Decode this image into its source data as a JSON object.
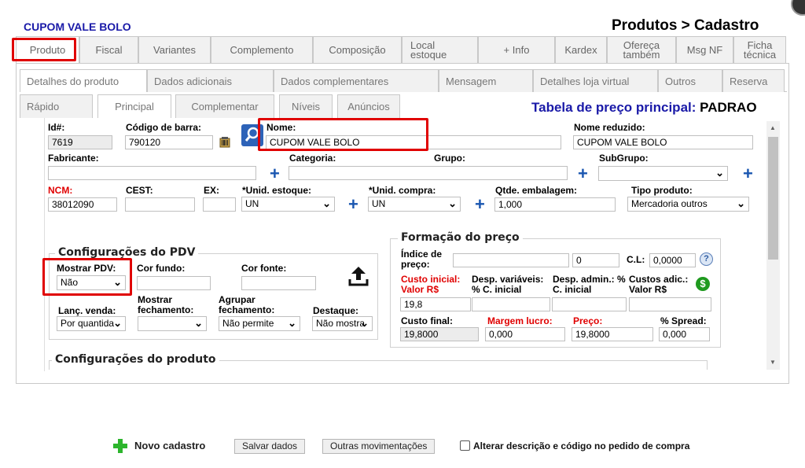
{
  "header": {
    "app_title": "CUPOM VALE BOLO",
    "page_title": "Produtos > Cadastro"
  },
  "tabs_main": [
    {
      "label": "Produto",
      "active": true
    },
    {
      "label": "Fiscal"
    },
    {
      "label": "Variantes"
    },
    {
      "label": "Complemento"
    },
    {
      "label": "Composição"
    },
    {
      "label": "Local estoque"
    },
    {
      "label": "+ Info"
    },
    {
      "label": "Kardex"
    },
    {
      "label": "Ofereça também"
    },
    {
      "label": "Msg NF"
    },
    {
      "label": "Ficha técnica"
    }
  ],
  "tabs_detail": [
    {
      "label": "Detalhes do produto",
      "active": true
    },
    {
      "label": "Dados adicionais"
    },
    {
      "label": "Dados complementares"
    },
    {
      "label": "Mensagem"
    },
    {
      "label": "Detalhes loja virtual"
    },
    {
      "label": "Outros"
    },
    {
      "label": "Reserva"
    }
  ],
  "tabs_sub": [
    {
      "label": "Rápido"
    },
    {
      "label": "Principal",
      "active": true
    },
    {
      "label": "Complementar"
    },
    {
      "label": "Níveis"
    },
    {
      "label": "Anúncios"
    }
  ],
  "price_table": {
    "label": "Tabela de preço principal:",
    "value": "PADRAO"
  },
  "form": {
    "id_label": "Id#:",
    "id_value": "7619",
    "barcode_label": "Código de barra:",
    "barcode_value": "790120",
    "name_label": "Nome:",
    "name_value": "CUPOM VALE BOLO",
    "short_name_label": "Nome reduzido:",
    "short_name_value": "CUPOM VALE BOLO",
    "manufacturer_label": "Fabricante:",
    "manufacturer_value": "",
    "category_label": "Categoria:",
    "category_value": "",
    "group_label": "Grupo:",
    "group_value": "",
    "subgroup_label": "SubGrupo:",
    "subgroup_value": "",
    "ncm_label": "NCM:",
    "ncm_value": "38012090",
    "cest_label": "CEST:",
    "cest_value": "",
    "ex_label": "EX:",
    "ex_value": "",
    "unit_stock_label": "*Unid. estoque:",
    "unit_stock_value": "UN",
    "unit_purchase_label": "*Unid. compra:",
    "unit_purchase_value": "UN",
    "package_qty_label": "Qtde. embalagem:",
    "package_qty_value": "1,000",
    "product_type_label": "Tipo produto:",
    "product_type_value": "Mercadoria outros"
  },
  "pdv": {
    "title": "Configurações do PDV",
    "show_label": "Mostrar PDV:",
    "show_value": "Não",
    "bg_color_label": "Cor fundo:",
    "bg_color_value": "",
    "font_color_label": "Cor fonte:",
    "font_color_value": "",
    "sale_launch_label": "Lanç. venda:",
    "sale_launch_value": "Por quantida",
    "show_close_label": "Mostrar fechamento:",
    "show_close_value": "",
    "group_close_label": "Agrupar fechamento:",
    "group_close_value": "Não permite",
    "highlight_label": "Destaque:",
    "highlight_value": "Não mostra"
  },
  "pricing": {
    "title": "Formação do preço",
    "index_label": "Índice de preço:",
    "index_value": "",
    "index_num": "0",
    "cl_label": "C.L:",
    "cl_value": "0,0000",
    "initial_cost_label": "Custo inicial: Valor R$",
    "initial_cost_value": "19,8",
    "var_exp_label": "Desp. variáveis: % C. inicial",
    "var_exp_value": "",
    "admin_exp_label": "Desp. admin.: % C. inicial",
    "admin_exp_value": "",
    "add_cost_label": "Custos adic.: Valor R$",
    "add_cost_value": "",
    "final_cost_label": "Custo final:",
    "final_cost_value": "19,8000",
    "margin_label": "Margem lucro:",
    "margin_value": "0,000",
    "price_label": "Preço:",
    "price_value": "19,8000",
    "spread_label": "% Spread:",
    "spread_value": "0,000"
  },
  "product_config": {
    "title": "Configurações do produto"
  },
  "footer": {
    "new_label": "Novo cadastro",
    "save_label": "Salvar dados",
    "other_label": "Outras movimentações",
    "checkbox_label": "Alterar descrição e código no pedido de compra"
  },
  "colors": {
    "accent_blue": "#1a1aa8",
    "highlight_red": "#e00000",
    "plus_green": "#2db52d",
    "money_green": "#1f9a1f"
  }
}
